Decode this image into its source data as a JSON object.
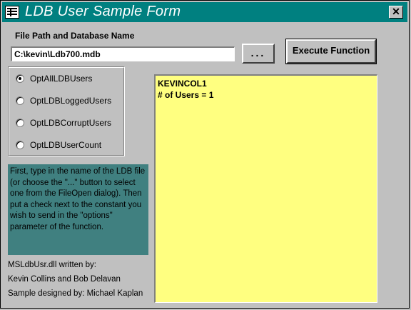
{
  "window": {
    "title": "LDB User Sample Form",
    "close_label": "✕"
  },
  "form": {
    "path_label": "File Path and Database Name",
    "path_value": "C:\\kevin\\Ldb700.mdb",
    "browse_label": "...",
    "execute_label": "Execute Function",
    "options": [
      {
        "label": "OptAllLDBUsers",
        "selected": true
      },
      {
        "label": "OptLDBLoggedUsers",
        "selected": false
      },
      {
        "label": "OptLDBCorruptUsers",
        "selected": false
      },
      {
        "label": "OptLDBUserCount",
        "selected": false
      }
    ],
    "instructions": "First, type in the name of the LDB file (or choose the \"...\" button to select one from the FileOpen dialog). Then put a check next to the constant you wish to send in the \"options\" parameter of the function.",
    "output_lines": [
      "KEVINCOL1",
      "# of Users = 1"
    ],
    "credits": [
      "MSLdbUsr.dll written by:",
      "Kevin Collins and Bob Delavan",
      "Sample designed by: Michael Kaplan"
    ]
  },
  "colors": {
    "titlebar": "#008080",
    "instructions_bg": "#408080",
    "output_bg": "#ffff80",
    "window_bg": "#c0c0c0"
  }
}
